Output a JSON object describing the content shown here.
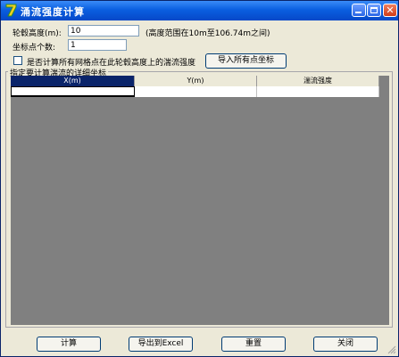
{
  "window": {
    "title": "涌流强度计算"
  },
  "form": {
    "height_label": "轮毂高度(m):",
    "height_value": "10",
    "height_range_note": "(高度范围在10m至106.74m之间)",
    "points_label": "坐标点个数:",
    "points_value": "1",
    "all_grid_checkbox_label": "是否计算所有网格点在此轮毂高度上的湍流强度",
    "all_grid_checked": false,
    "import_button": "导入所有点坐标"
  },
  "group": {
    "title": "指定要计算湍流的详细坐标"
  },
  "grid": {
    "columns": [
      "X(m)",
      "Y(m)",
      "湍流强度"
    ],
    "rows": [
      [
        "",
        "",
        ""
      ]
    ]
  },
  "buttons": {
    "calc": "计算",
    "export": "导出到Excel",
    "reset": "重置",
    "close": "关闭"
  },
  "colors": {
    "titlebar": "#0a5fe0",
    "selected_header": "#0a246a",
    "window_bg": "#ece9d8"
  }
}
